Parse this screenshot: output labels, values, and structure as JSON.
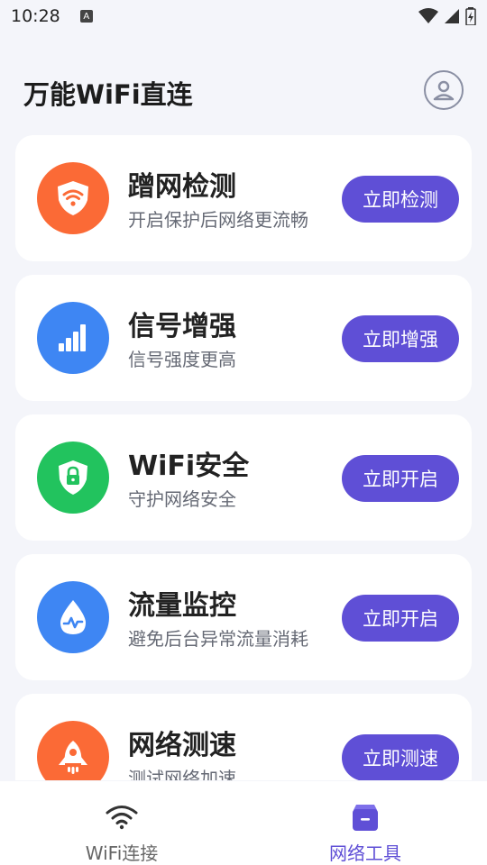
{
  "status_bar": {
    "time": "10:28",
    "a_label": "A"
  },
  "header": {
    "title": "万能WiFi直连"
  },
  "cards": [
    {
      "title": "蹭网检测",
      "subtitle": "开启保护后网络更流畅",
      "action": "立即检测",
      "icon": "wifi-shield-icon",
      "color": "#fb6a36"
    },
    {
      "title": "信号增强",
      "subtitle": "信号强度更高",
      "action": "立即增强",
      "icon": "signal-bars-icon",
      "color": "#3e86f3"
    },
    {
      "title": "WiFi安全",
      "subtitle": "守护网络安全",
      "action": "立即开启",
      "icon": "lock-shield-icon",
      "color": "#22c35e"
    },
    {
      "title": "流量监控",
      "subtitle": "避免后台异常流量消耗",
      "action": "立即开启",
      "icon": "water-drop-icon",
      "color": "#3e86f3"
    },
    {
      "title": "网络测速",
      "subtitle": "测试网络加速",
      "action": "立即测速",
      "icon": "rocket-icon",
      "color": "#fb6a36"
    }
  ],
  "accent_color": "#5f4fd6",
  "tabbar": {
    "tabs": [
      {
        "label": "WiFi连接",
        "icon": "wifi-icon",
        "active": false
      },
      {
        "label": "网络工具",
        "icon": "toolbox-icon",
        "active": true
      }
    ]
  }
}
